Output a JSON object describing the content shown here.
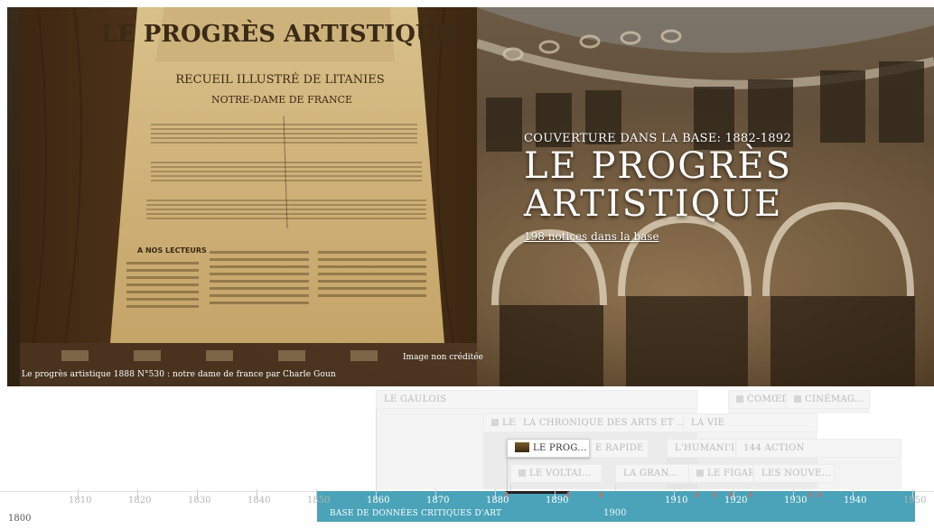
{
  "hero": {
    "coverage": "COUVERTURE DANS LA BASE: 1882-1892",
    "title_line1": "LE PROGRÈS",
    "title_line2": "ARTISTIQUE",
    "count_link": "198 notices dans la base",
    "image_caption": "Le progrès artistique 1888 N°530 : notre dame de france par Charle Goun",
    "image_credit": "Image non créditée",
    "newspaper_masthead": "LE PROGRÈS ARTISTIQUE",
    "newspaper_subtitle": "RECUEIL ILLUSTRÉ DE LITANIES",
    "newspaper_heading": "NOTRE-DAME DE FRANCE",
    "newspaper_section": "A NOS LECTEURS"
  },
  "timeline": {
    "events": [
      {
        "label": "LE GAULOIS",
        "thumb": false
      },
      {
        "label": "COMŒDI",
        "thumb": true
      },
      {
        "label": "CINÉMAG...",
        "thumb": true
      },
      {
        "label": "LE",
        "thumb": true
      },
      {
        "label": "LA CHRONIQUE DES ARTS ET ...",
        "thumb": false
      },
      {
        "label": "LA VIE",
        "thumb": false
      },
      {
        "label": "LE PROG...",
        "thumb": true,
        "active": true
      },
      {
        "label": "E RAPIDE",
        "thumb": false
      },
      {
        "label": "L'HUMANI'I",
        "thumb": false
      },
      {
        "label": "144 ACTION",
        "thumb": false
      },
      {
        "label": "LE VOLTAI...",
        "thumb": true
      },
      {
        "label": "LA GRAN...",
        "thumb": false
      },
      {
        "label": "LE FIGAR",
        "thumb": true
      },
      {
        "label": "LES NOUVE...",
        "thumb": false
      }
    ],
    "ticks": [
      "1800",
      "1810",
      "1820",
      "1830",
      "1840",
      "1850",
      "1860",
      "1870",
      "1880",
      "1890",
      "1900",
      "1910",
      "1920",
      "1930",
      "1940",
      "1950"
    ],
    "era_label": "BASE DE DONNÉES CRITIQUES D'ART"
  },
  "colors": {
    "era_base": "#4aa3b8",
    "marker": "#d9675a"
  }
}
